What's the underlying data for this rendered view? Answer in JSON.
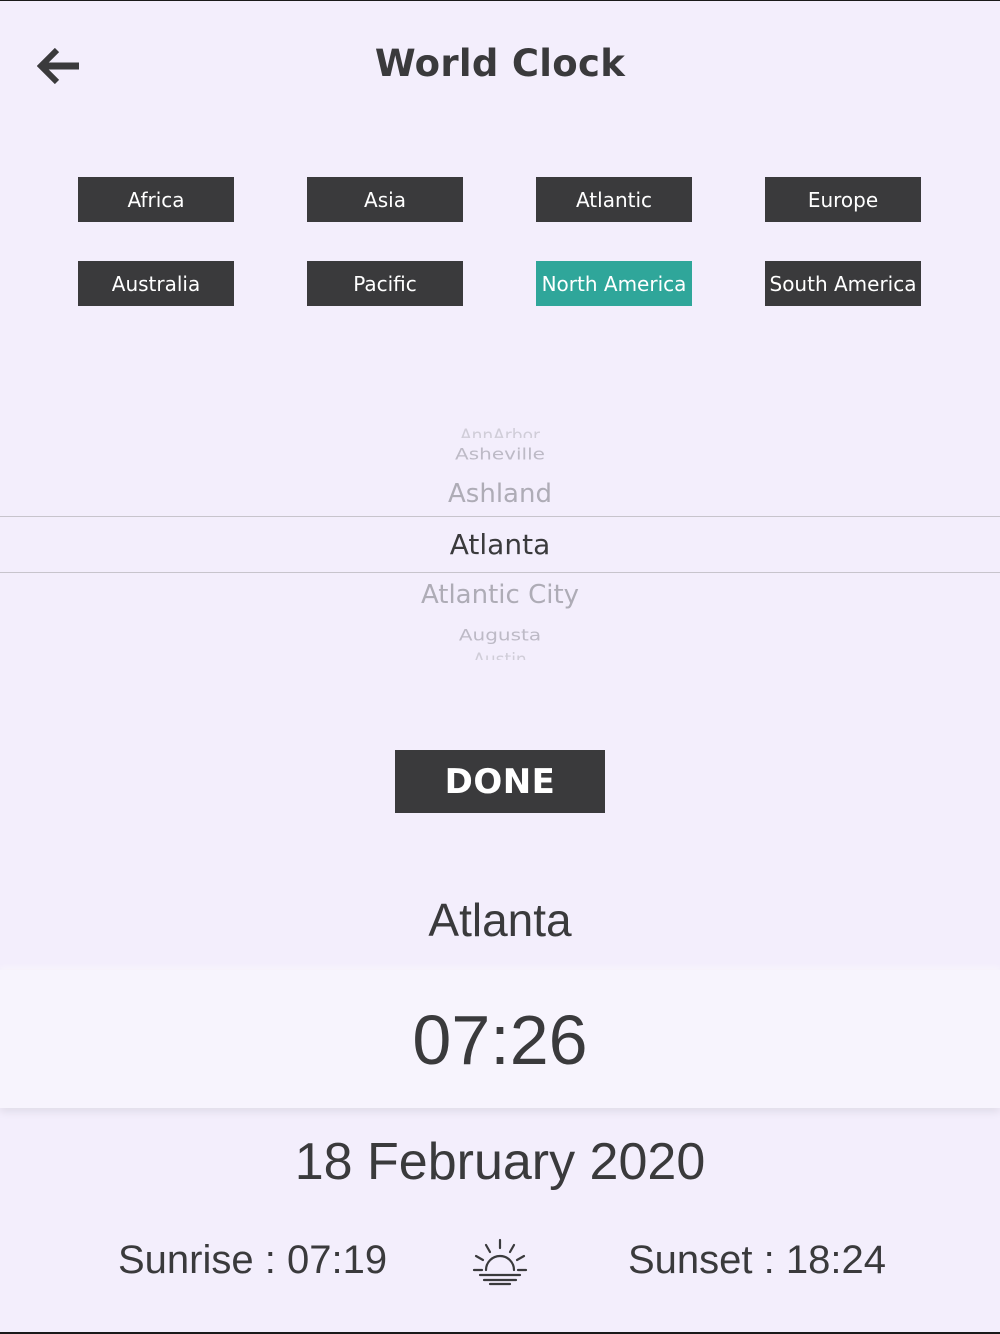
{
  "header": {
    "title": "World Clock",
    "back_icon": "arrow-left-icon"
  },
  "regions": [
    {
      "label": "Africa",
      "active": false
    },
    {
      "label": "Asia",
      "active": false
    },
    {
      "label": "Atlantic",
      "active": false
    },
    {
      "label": "Europe",
      "active": false
    },
    {
      "label": "Australia",
      "active": false
    },
    {
      "label": "Pacific",
      "active": false
    },
    {
      "label": "North America",
      "active": true
    },
    {
      "label": "South America",
      "active": false
    }
  ],
  "picker": {
    "items": [
      "AnnArbor",
      "Asheville",
      "Ashland",
      "Atlanta",
      "Atlantic City",
      "Augusta",
      "Austin"
    ],
    "selected": "Atlanta"
  },
  "done_label": "DONE",
  "clock": {
    "city": "Atlanta",
    "time": "07:26",
    "date": "18 February 2020",
    "sunrise": "Sunrise : 07:19",
    "sunset": "Sunset : 18:24",
    "sun_icon": "sunrise-icon"
  },
  "colors": {
    "background": "#f3eefc",
    "button": "#3a3a3c",
    "active_button": "#2fa69a"
  }
}
